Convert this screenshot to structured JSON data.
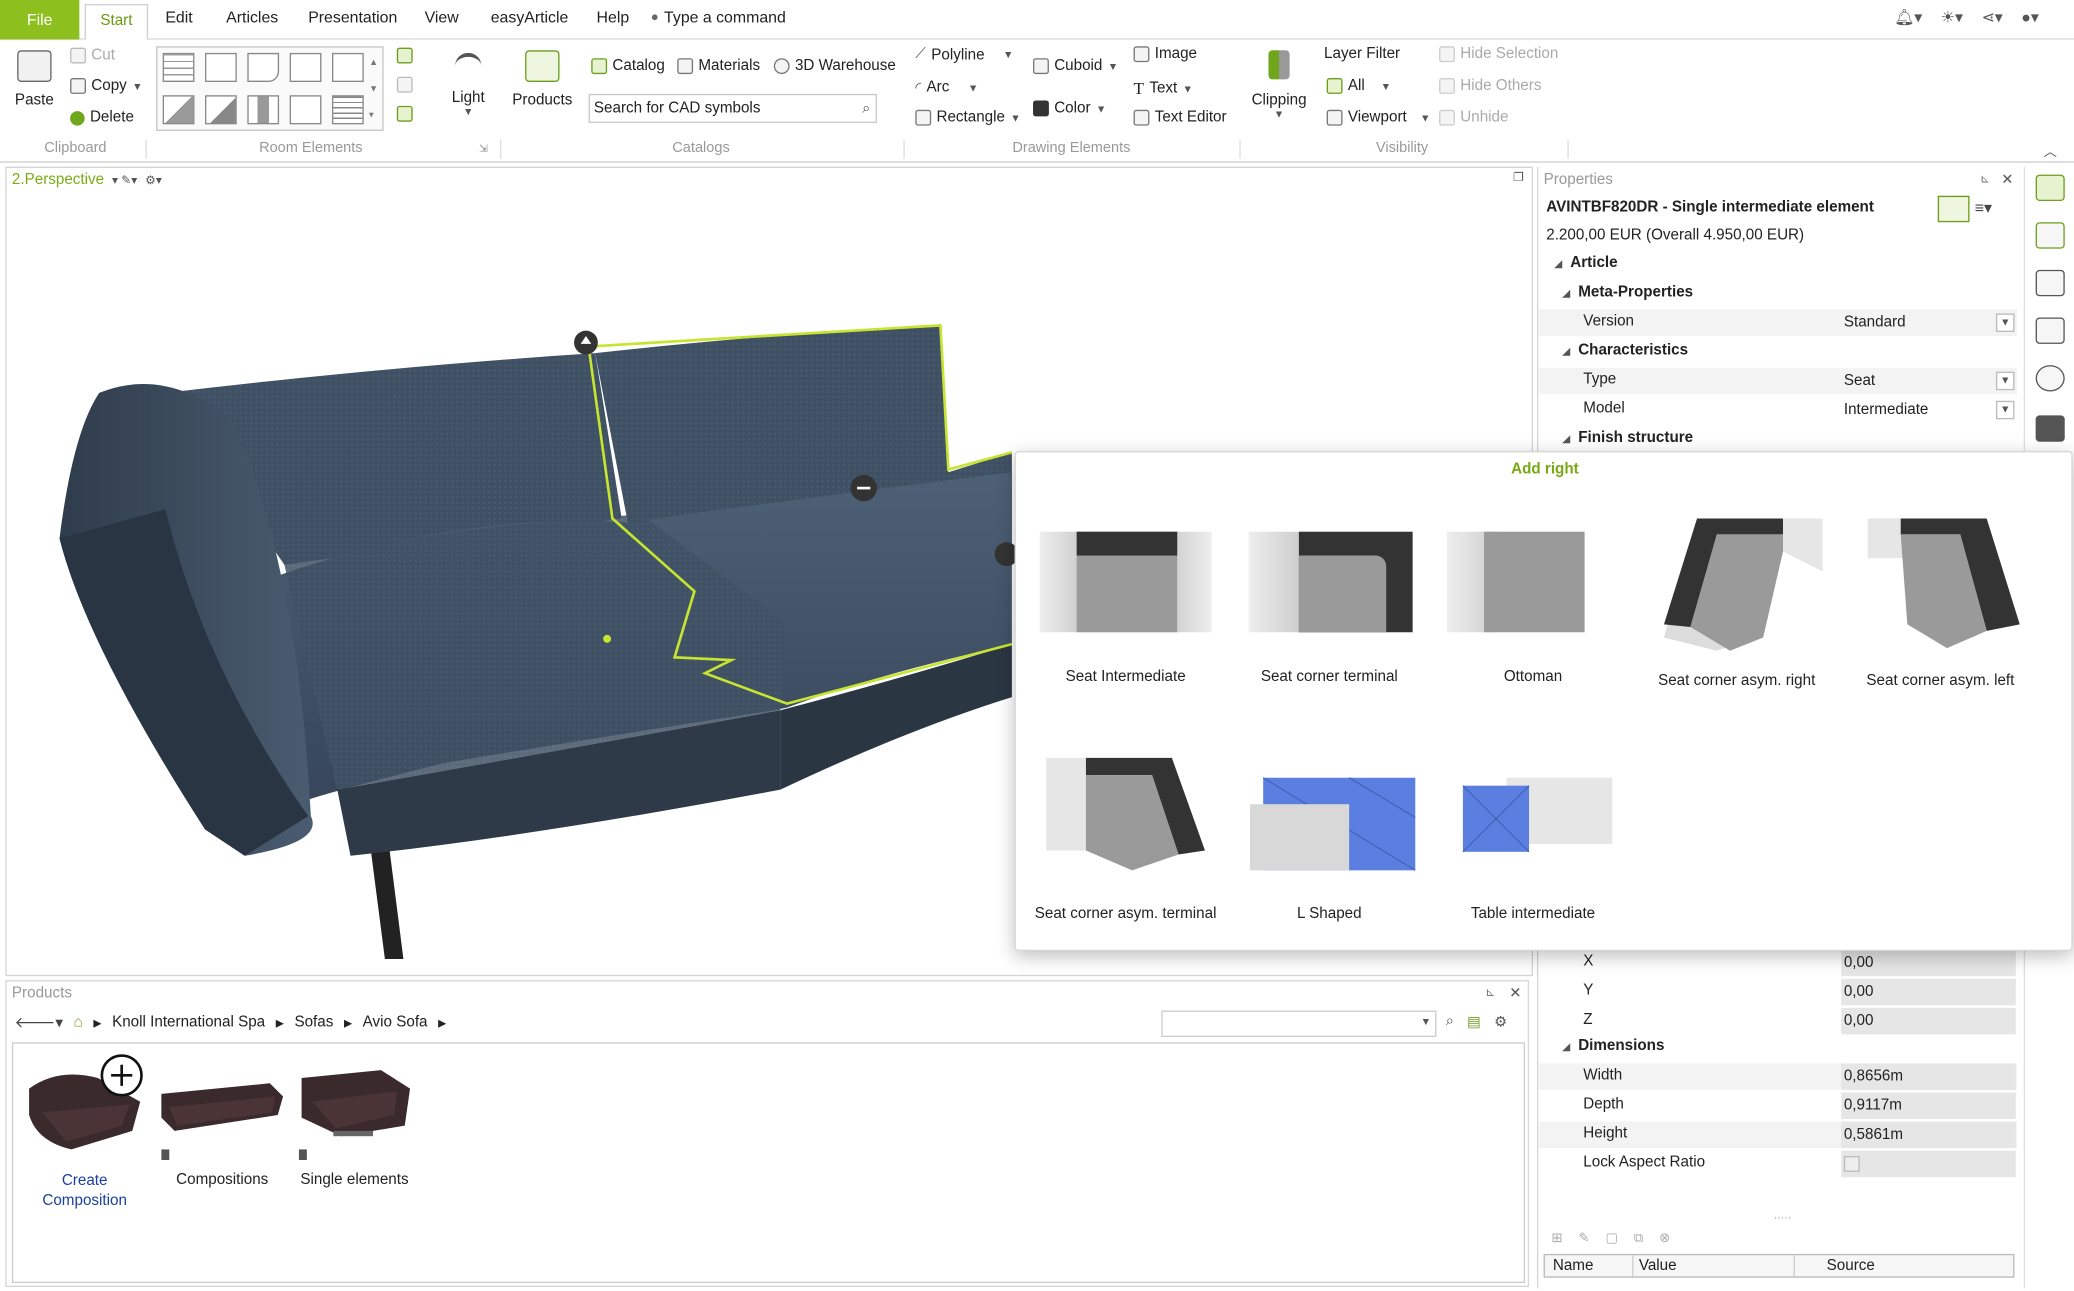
{
  "menu": {
    "file": "File",
    "tabs": [
      "Start",
      "Edit",
      "Articles",
      "Presentation",
      "View",
      "easyArticle",
      "Help"
    ],
    "command_placeholder": "Type a command"
  },
  "ribbon": {
    "clipboard": {
      "paste": "Paste",
      "cut": "Cut",
      "copy": "Copy",
      "delete": "Delete",
      "label": "Clipboard"
    },
    "room_elements": {
      "label": "Room Elements"
    },
    "light": "Light",
    "products": "Products",
    "catalogs": {
      "catalog": "Catalog",
      "materials": "Materials",
      "warehouse": "3D Warehouse",
      "search_value": "Search for CAD symbols",
      "label": "Catalogs"
    },
    "drawing": {
      "polyline": "Polyline",
      "arc": "Arc",
      "rectangle": "Rectangle",
      "cuboid": "Cuboid",
      "color": "Color",
      "image": "Image",
      "text": "Text",
      "text_editor": "Text Editor",
      "label": "Drawing Elements"
    },
    "clipping": "Clipping",
    "visibility": {
      "layer_filter": "Layer Filter",
      "all": "All",
      "viewport": "Viewport",
      "hide_selection": "Hide Selection",
      "hide_others": "Hide Others",
      "unhide": "Unhide",
      "label": "Visibility"
    }
  },
  "viewport": {
    "label": "2.Perspective"
  },
  "popup": {
    "title": "Add right",
    "items": [
      "Seat Intermediate",
      "Seat corner terminal",
      "Ottoman",
      "Seat corner asym. right",
      "Seat corner asym. left",
      "Seat corner asym. terminal",
      "L Shaped",
      "Table intermediate"
    ]
  },
  "properties": {
    "title": "Properties",
    "article_name": "AVINTBF820DR - Single intermediate element",
    "price": "2.200,00 EUR (Overall 4.950,00 EUR)",
    "article": "Article",
    "meta": "Meta-Properties",
    "version_k": "Version",
    "version_v": "Standard",
    "characteristics": "Characteristics",
    "type_k": "Type",
    "type_v": "Seat",
    "model_k": "Model",
    "model_v": "Intermediate",
    "finish": "Finish structure",
    "x_k": "X",
    "x_v": "0,00",
    "y_k": "Y",
    "y_v": "0,00",
    "z_k": "Z",
    "z_v": "0,00",
    "dimensions": "Dimensions",
    "width_k": "Width",
    "width_v": "0,8656m",
    "depth_k": "Depth",
    "depth_v": "0,9117m",
    "height_k": "Height",
    "height_v": "0,5861m",
    "lock_k": "Lock Aspect Ratio",
    "cols": [
      "Name",
      "Value",
      "Source"
    ]
  },
  "products_panel": {
    "title": "Products",
    "breadcrumb": [
      "Knoll International Spa",
      "Sofas",
      "Avio Sofa"
    ],
    "items": [
      "Create Composition",
      "Compositions",
      "Single elements"
    ]
  },
  "colors": {
    "accent": "#8dbf1f",
    "sofa": "#3e4f62",
    "outline": "#c6e430"
  }
}
